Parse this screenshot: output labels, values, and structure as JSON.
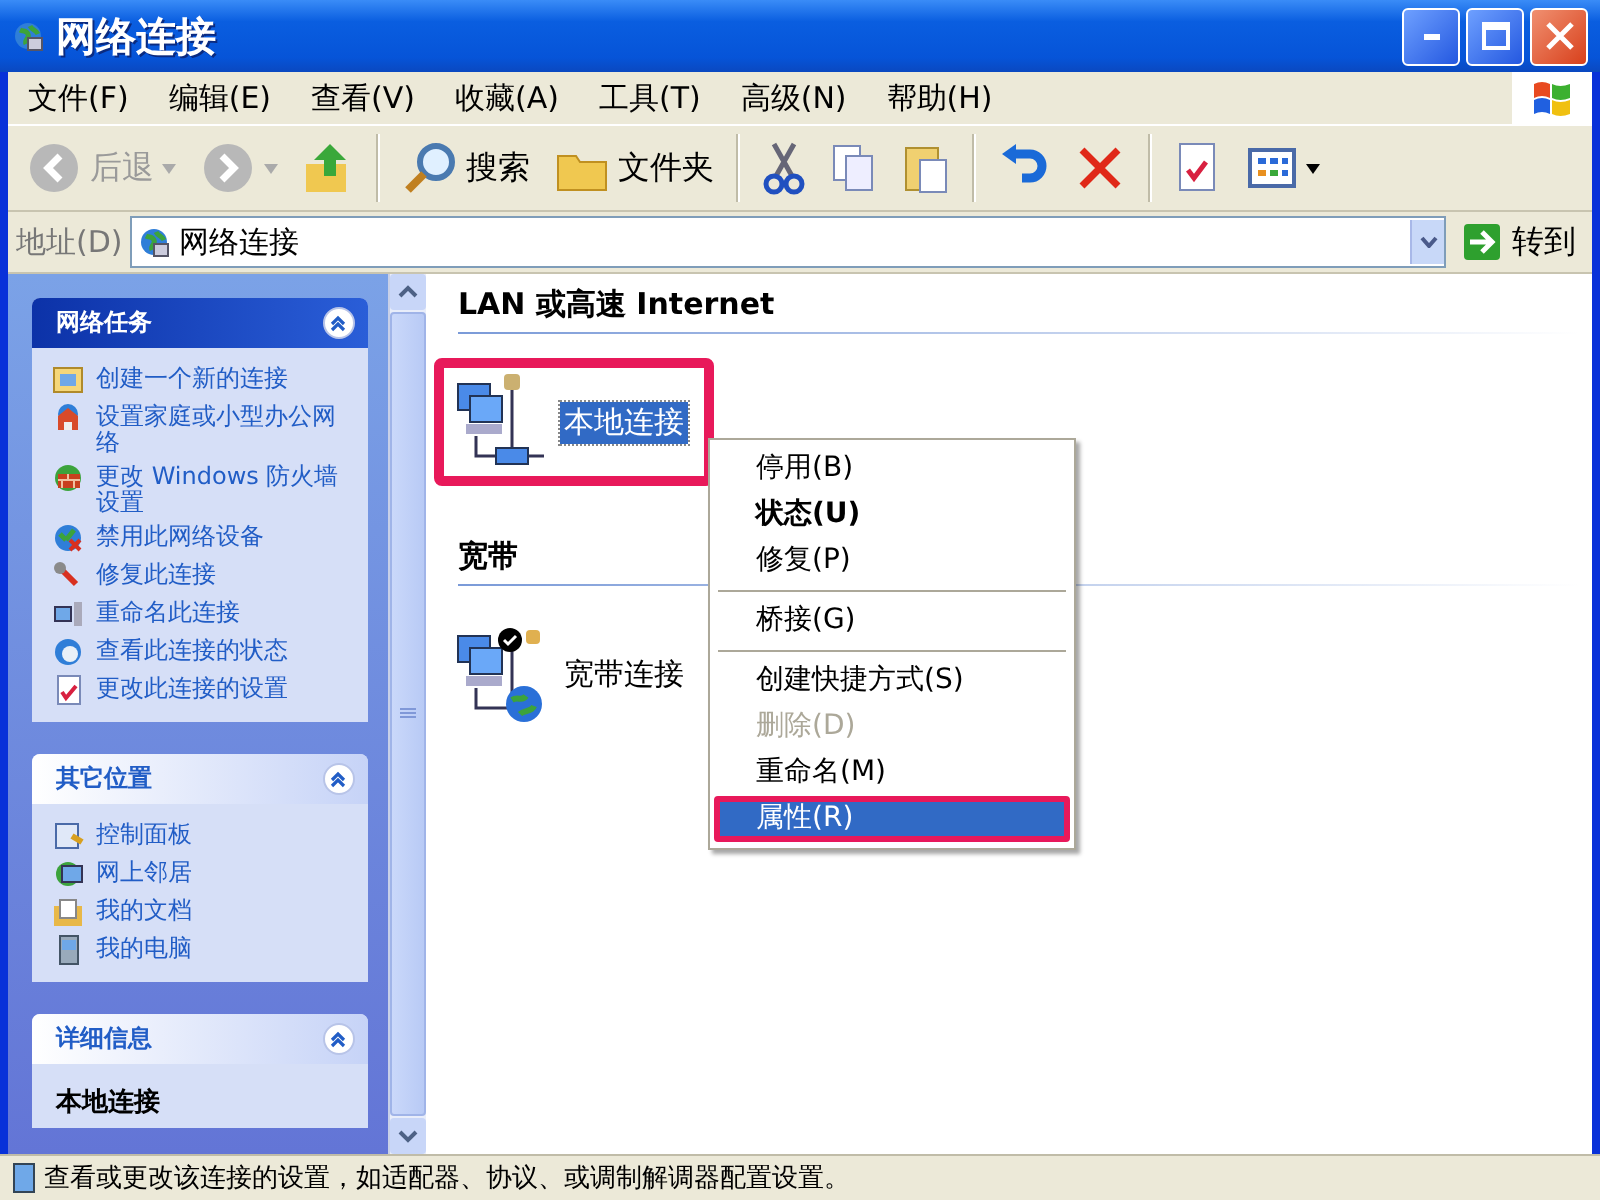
{
  "window": {
    "title": "网络连接"
  },
  "menu_bar": [
    {
      "label": "文件(F)"
    },
    {
      "label": "编辑(E)"
    },
    {
      "label": "查看(V)"
    },
    {
      "label": "收藏(A)"
    },
    {
      "label": "工具(T)"
    },
    {
      "label": "高级(N)"
    },
    {
      "label": "帮助(H)"
    }
  ],
  "toolbar": [
    {
      "kind": "back",
      "label": "后退",
      "disabled": true
    },
    {
      "kind": "forward",
      "disabled": true
    },
    {
      "kind": "up",
      "disabled": false
    },
    {
      "kind": "separator"
    },
    {
      "kind": "search",
      "label": "搜索",
      "disabled": false
    },
    {
      "kind": "folders",
      "label": "文件夹",
      "disabled": false
    },
    {
      "kind": "separator"
    },
    {
      "kind": "cut",
      "disabled": false
    },
    {
      "kind": "copy",
      "disabled": false
    },
    {
      "kind": "paste",
      "disabled": false
    },
    {
      "kind": "separator"
    },
    {
      "kind": "undo",
      "disabled": false
    },
    {
      "kind": "delete",
      "disabled": false
    },
    {
      "kind": "separator"
    },
    {
      "kind": "properties",
      "disabled": false
    },
    {
      "kind": "views",
      "disabled": false
    }
  ],
  "address_bar": {
    "label": "地址(D)",
    "value": "网络连接",
    "go_label": "转到"
  },
  "task_pane": {
    "sections": [
      {
        "kind": "links",
        "title": "网络任务",
        "special": true,
        "expanded": true,
        "items": [
          {
            "kind": "new",
            "label": "创建一个新的连接"
          },
          {
            "kind": "home",
            "label": "设置家庭或小型办公网络"
          },
          {
            "kind": "firewall",
            "label": "更改 Windows 防火墙设置"
          },
          {
            "kind": "disable",
            "label": "禁用此网络设备"
          },
          {
            "kind": "repair",
            "label": "修复此连接"
          },
          {
            "kind": "rename",
            "label": "重命名此连接"
          },
          {
            "kind": "status",
            "label": "查看此连接的状态"
          },
          {
            "kind": "settings",
            "label": "更改此连接的设置"
          }
        ]
      },
      {
        "kind": "links",
        "title": "其它位置",
        "special": false,
        "expanded": true,
        "items": [
          {
            "kind": "control",
            "label": "控制面板"
          },
          {
            "kind": "network",
            "label": "网上邻居"
          },
          {
            "kind": "docs",
            "label": "我的文档"
          },
          {
            "kind": "computer",
            "label": "我的电脑"
          }
        ]
      },
      {
        "kind": "details",
        "title": "详细信息",
        "special": false,
        "expanded": true,
        "text": "本地连接"
      }
    ]
  },
  "content": {
    "groups": [
      {
        "title": "LAN 或高速 Internet",
        "connections": [
          {
            "kind": "lan",
            "name": "本地连接",
            "selected": true,
            "highlighted": true
          }
        ]
      },
      {
        "title": "宽带",
        "connections": [
          {
            "kind": "broadband",
            "name": "宽带连接",
            "selected": false,
            "highlighted": false
          }
        ]
      }
    ]
  },
  "context_menu": {
    "items": [
      {
        "kind": "item",
        "label": "停用(B)",
        "default": false,
        "disabled": false,
        "selected": false,
        "highlighted": false
      },
      {
        "kind": "item",
        "label": "状态(U)",
        "default": true,
        "disabled": false,
        "selected": false,
        "highlighted": false
      },
      {
        "kind": "item",
        "label": "修复(P)",
        "default": false,
        "disabled": false,
        "selected": false,
        "highlighted": false
      },
      {
        "kind": "separator"
      },
      {
        "kind": "item",
        "label": "桥接(G)",
        "default": false,
        "disabled": false,
        "selected": false,
        "highlighted": false
      },
      {
        "kind": "separator"
      },
      {
        "kind": "item",
        "label": "创建快捷方式(S)",
        "default": false,
        "disabled": false,
        "selected": false,
        "highlighted": false
      },
      {
        "kind": "item",
        "label": "删除(D)",
        "default": false,
        "disabled": true,
        "selected": false,
        "highlighted": false
      },
      {
        "kind": "item",
        "label": "重命名(M)",
        "default": false,
        "disabled": false,
        "selected": false,
        "highlighted": false
      },
      {
        "kind": "item",
        "label": "属性(R)",
        "default": false,
        "disabled": false,
        "selected": true,
        "highlighted": true
      }
    ]
  },
  "status_bar": {
    "text": "查看或更改该连接的设置，如适配器、协议、或调制解调器配置设置。"
  }
}
